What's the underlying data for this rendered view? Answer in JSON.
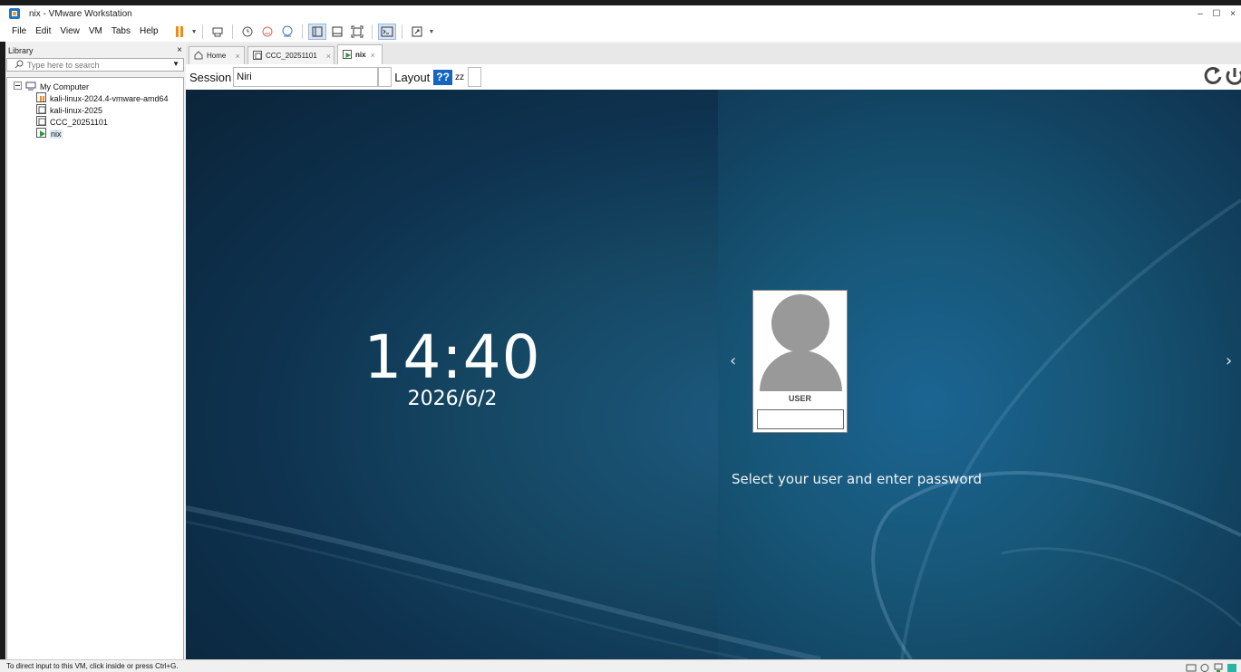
{
  "window": {
    "title": "nix - VMware Workstation",
    "ghost_title": "nix - VMware Workstation",
    "controls": [
      "–",
      "☐",
      "×"
    ]
  },
  "menu": [
    "File",
    "Edit",
    "View",
    "VM",
    "Tabs",
    "Help"
  ],
  "toolbar": {
    "icons": [
      "pause-icon",
      "send-ctrl-alt-del-icon",
      "snapshot-icon",
      "revert-snapshot-icon",
      "snapshot-manager-icon",
      "library-view-icon",
      "thumbnail-bar-icon",
      "fullscreen-icon",
      "console-icon",
      "stretch-icon"
    ]
  },
  "library": {
    "title": "Library",
    "close": "×",
    "search_placeholder": "Type here to search",
    "root": "My Computer",
    "items": [
      {
        "label": "kali-linux-2024.4-vmware-amd64",
        "state": "paused"
      },
      {
        "label": "kali-linux-2025",
        "state": "off"
      },
      {
        "label": "CCC_20251101",
        "state": "off"
      },
      {
        "label": "nix",
        "state": "running",
        "selected": true
      }
    ]
  },
  "tabs": [
    {
      "label": "Home",
      "close": "×",
      "active": false
    },
    {
      "label": "CCC_20251101",
      "close": "×",
      "active": false
    },
    {
      "label": "nix",
      "close": "×",
      "active": true
    }
  ],
  "greeter": {
    "session_label": "Session",
    "session_value": "Niri",
    "layout_label": "Layout",
    "layout_value": "??",
    "layout_alt": "zz",
    "time": "14:40",
    "date": "2026/6/2",
    "user_name": "USER",
    "prompt": "Select your user and enter password",
    "prev_arrow": "‹",
    "next_arrow": "›"
  },
  "status": {
    "message": "To direct input to this VM, click inside or press Ctrl+G."
  },
  "colors": {
    "accent": "#1565c0",
    "pause": "#f08a1c",
    "vm_bg": "#154763"
  }
}
